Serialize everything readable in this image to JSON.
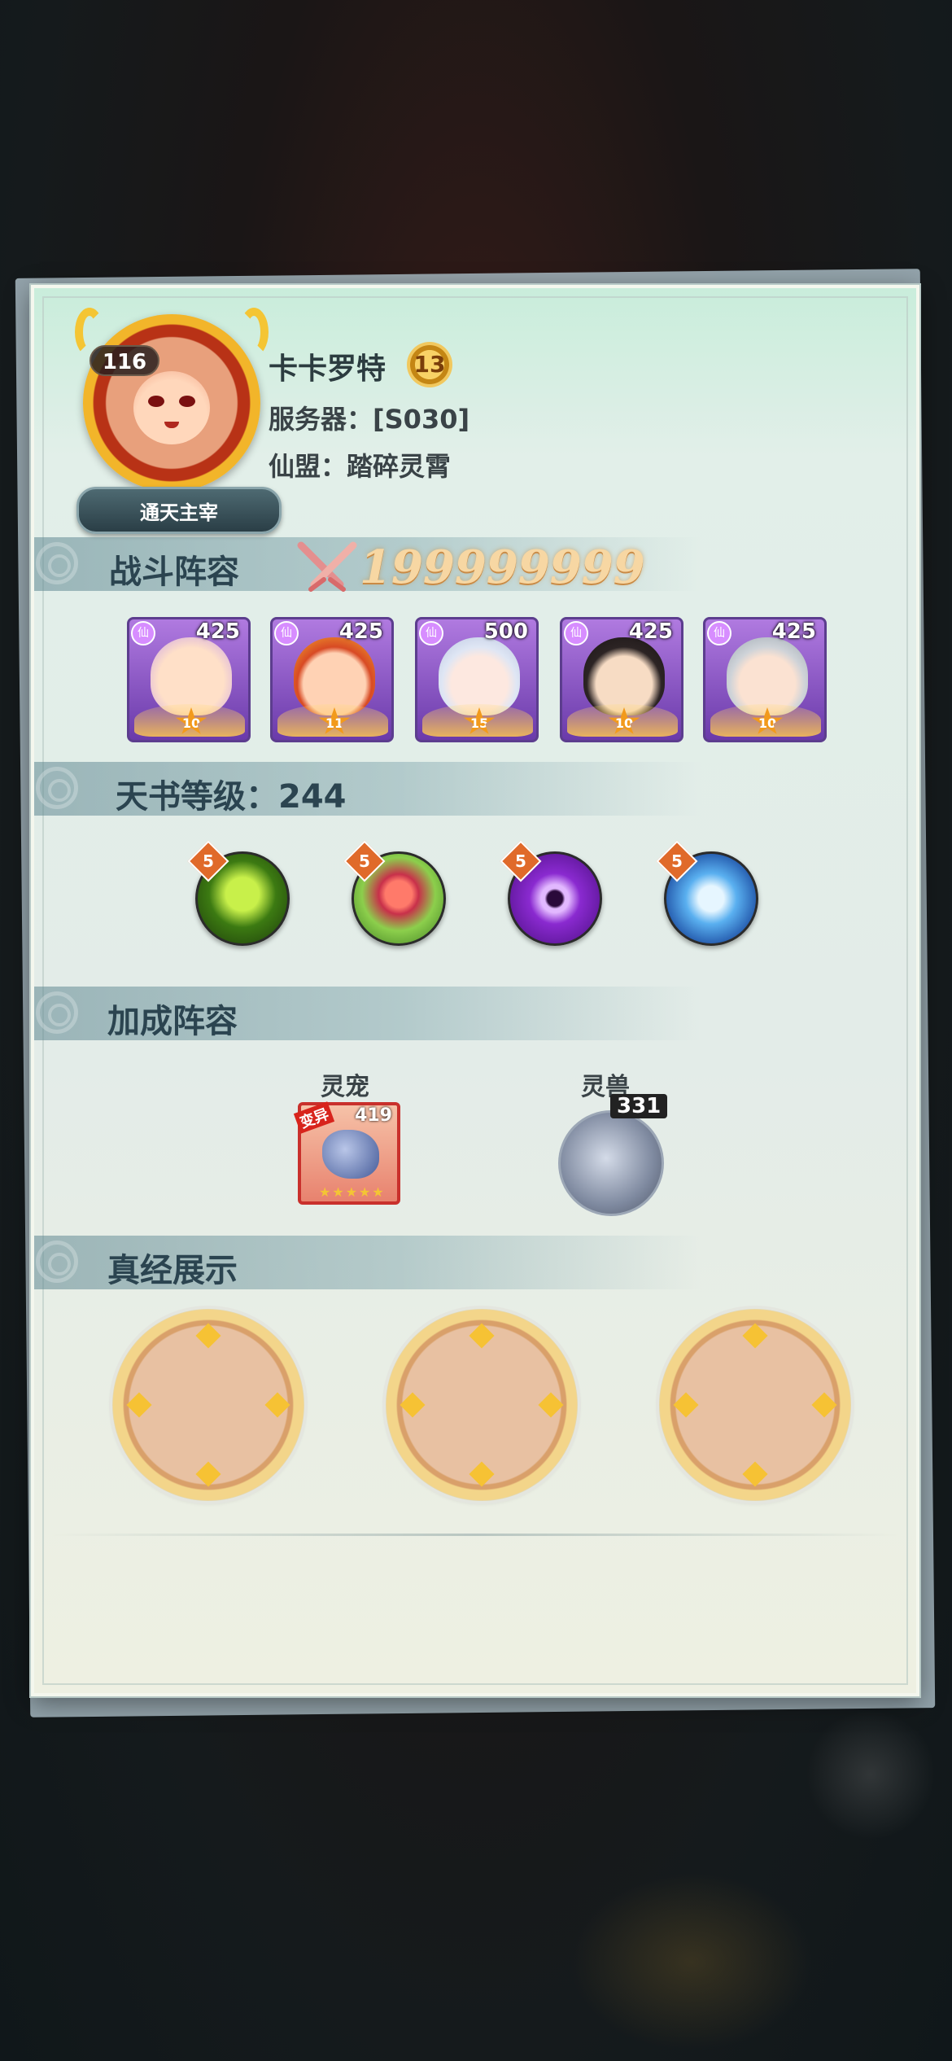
{
  "profile": {
    "avatar_level": "116",
    "title": "通天主宰",
    "name": "卡卡罗特",
    "vip_level": "13",
    "server": "服务器：[S030]",
    "guild": "仙盟：踏碎灵霄"
  },
  "battle": {
    "header": "战斗阵容",
    "power": "199999999",
    "heroes": [
      {
        "level": "425",
        "stars": "10"
      },
      {
        "level": "425",
        "stars": "11"
      },
      {
        "level": "500",
        "stars": "15"
      },
      {
        "level": "425",
        "stars": "10"
      },
      {
        "level": "425",
        "stars": "10"
      }
    ]
  },
  "tianshu": {
    "header": "天书等级：244",
    "skills": [
      {
        "level": "5",
        "icon": "green-poison-orb-icon"
      },
      {
        "level": "5",
        "icon": "bud-orb-icon"
      },
      {
        "level": "5",
        "icon": "purple-eye-orb-icon"
      },
      {
        "level": "5",
        "icon": "ice-crystal-orb-icon"
      }
    ]
  },
  "bonus": {
    "header": "加成阵容",
    "pet": {
      "label": "灵宠",
      "level": "419",
      "tag": "变异",
      "stars": "★★★★★"
    },
    "beast": {
      "label": "灵兽",
      "level": "331"
    }
  },
  "scripture": {
    "header": "真经展示"
  }
}
